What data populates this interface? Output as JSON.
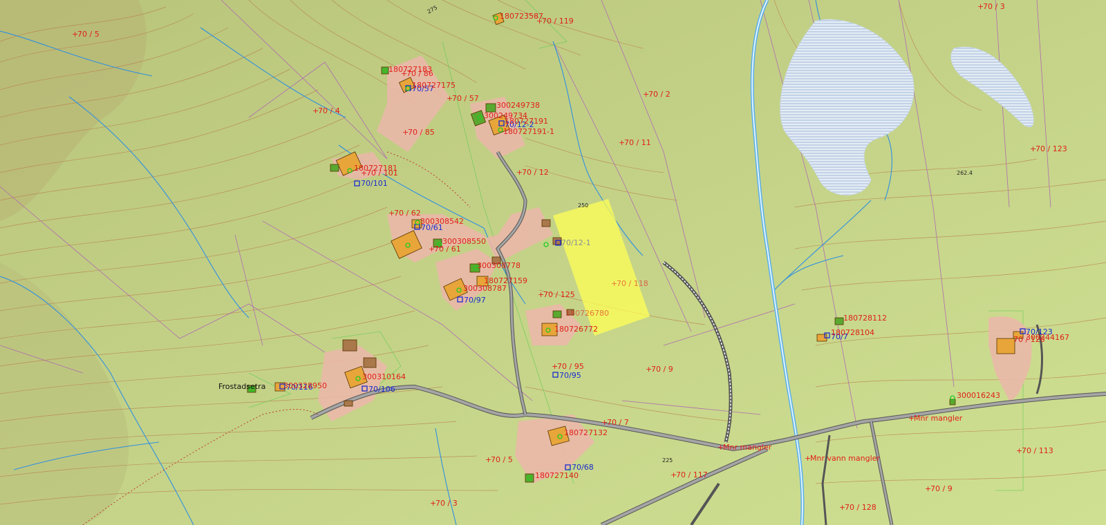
{
  "map": {
    "colors": {
      "terrain": "#c5d68a",
      "contour": "#b97a4a",
      "stream": "#2f8fe0",
      "property_line": "#b06ab0",
      "zone_line": "#66cc55",
      "road": "#6f6f6f",
      "plot": "#eab8a8",
      "building": "#e8a53a",
      "highlight": "#ffff55",
      "label_red": "#e0201a",
      "label_blue": "#1a2ad0"
    },
    "place_names": {
      "frostadsetra": "Frostadsetra"
    },
    "contour_labels": {
      "c275": "275",
      "c250": "250",
      "c225": "225",
      "spot": "262.4"
    },
    "parcels": {
      "p1": "70 / 5",
      "p2": "70 / 119",
      "p3": "70 / 3",
      "p4": "70 / 86",
      "p5": "70 / 57",
      "p6": "70 / 4",
      "p7": "70 / 2",
      "p8": "70 / 85",
      "p9": "70 / 11",
      "p10": "70 / 123",
      "p11": "70 / 101",
      "p12": "70 / 12",
      "p13": "70 / 62",
      "p14": "70 / 61",
      "p15": "70 / 118",
      "p16": "70 / 125",
      "p17": "70 / 95",
      "p18": "70 / 9",
      "p19": "70 / 7",
      "p20": "70 / 5",
      "p21": "70 / 117",
      "p22": "70 / 113",
      "p23": "70 / 3",
      "p24": "70 / 9",
      "p25": "70 / 128",
      "p26": "70 / 120"
    },
    "addresses": {
      "a1": "70/57",
      "a2": "70/12-2",
      "a3": "70/101",
      "a4": "70/61",
      "a5": "70/97",
      "a6": "70/95",
      "a7": "70/106",
      "a8": "70/116",
      "a9": "70/68",
      "a10": "70/123",
      "a11": "70/7",
      "a12": "70/12-1"
    },
    "buildings": {
      "b1": "180723587",
      "b2": "180727183",
      "b3": "180727175",
      "b4": "300249738",
      "b5": "300249734",
      "b6": "180727191",
      "b7": "180727191-1",
      "b8": "180727181",
      "b9": "300308542",
      "b10": "300308550",
      "b11": "300308778",
      "b12": "180727159",
      "b13": "300308787",
      "b14": "180726780",
      "b15": "180726772",
      "b16": "300310164",
      "b17": "300328950",
      "b18": "180727132",
      "b19": "180727140",
      "b20": "180728112",
      "b21": "180728104",
      "b22": "300244167",
      "b23": "300016243"
    },
    "missing": {
      "m1": "Mnr mangler",
      "m2": "Mnr mangler",
      "m3": "Mnr vann mangler"
    }
  }
}
